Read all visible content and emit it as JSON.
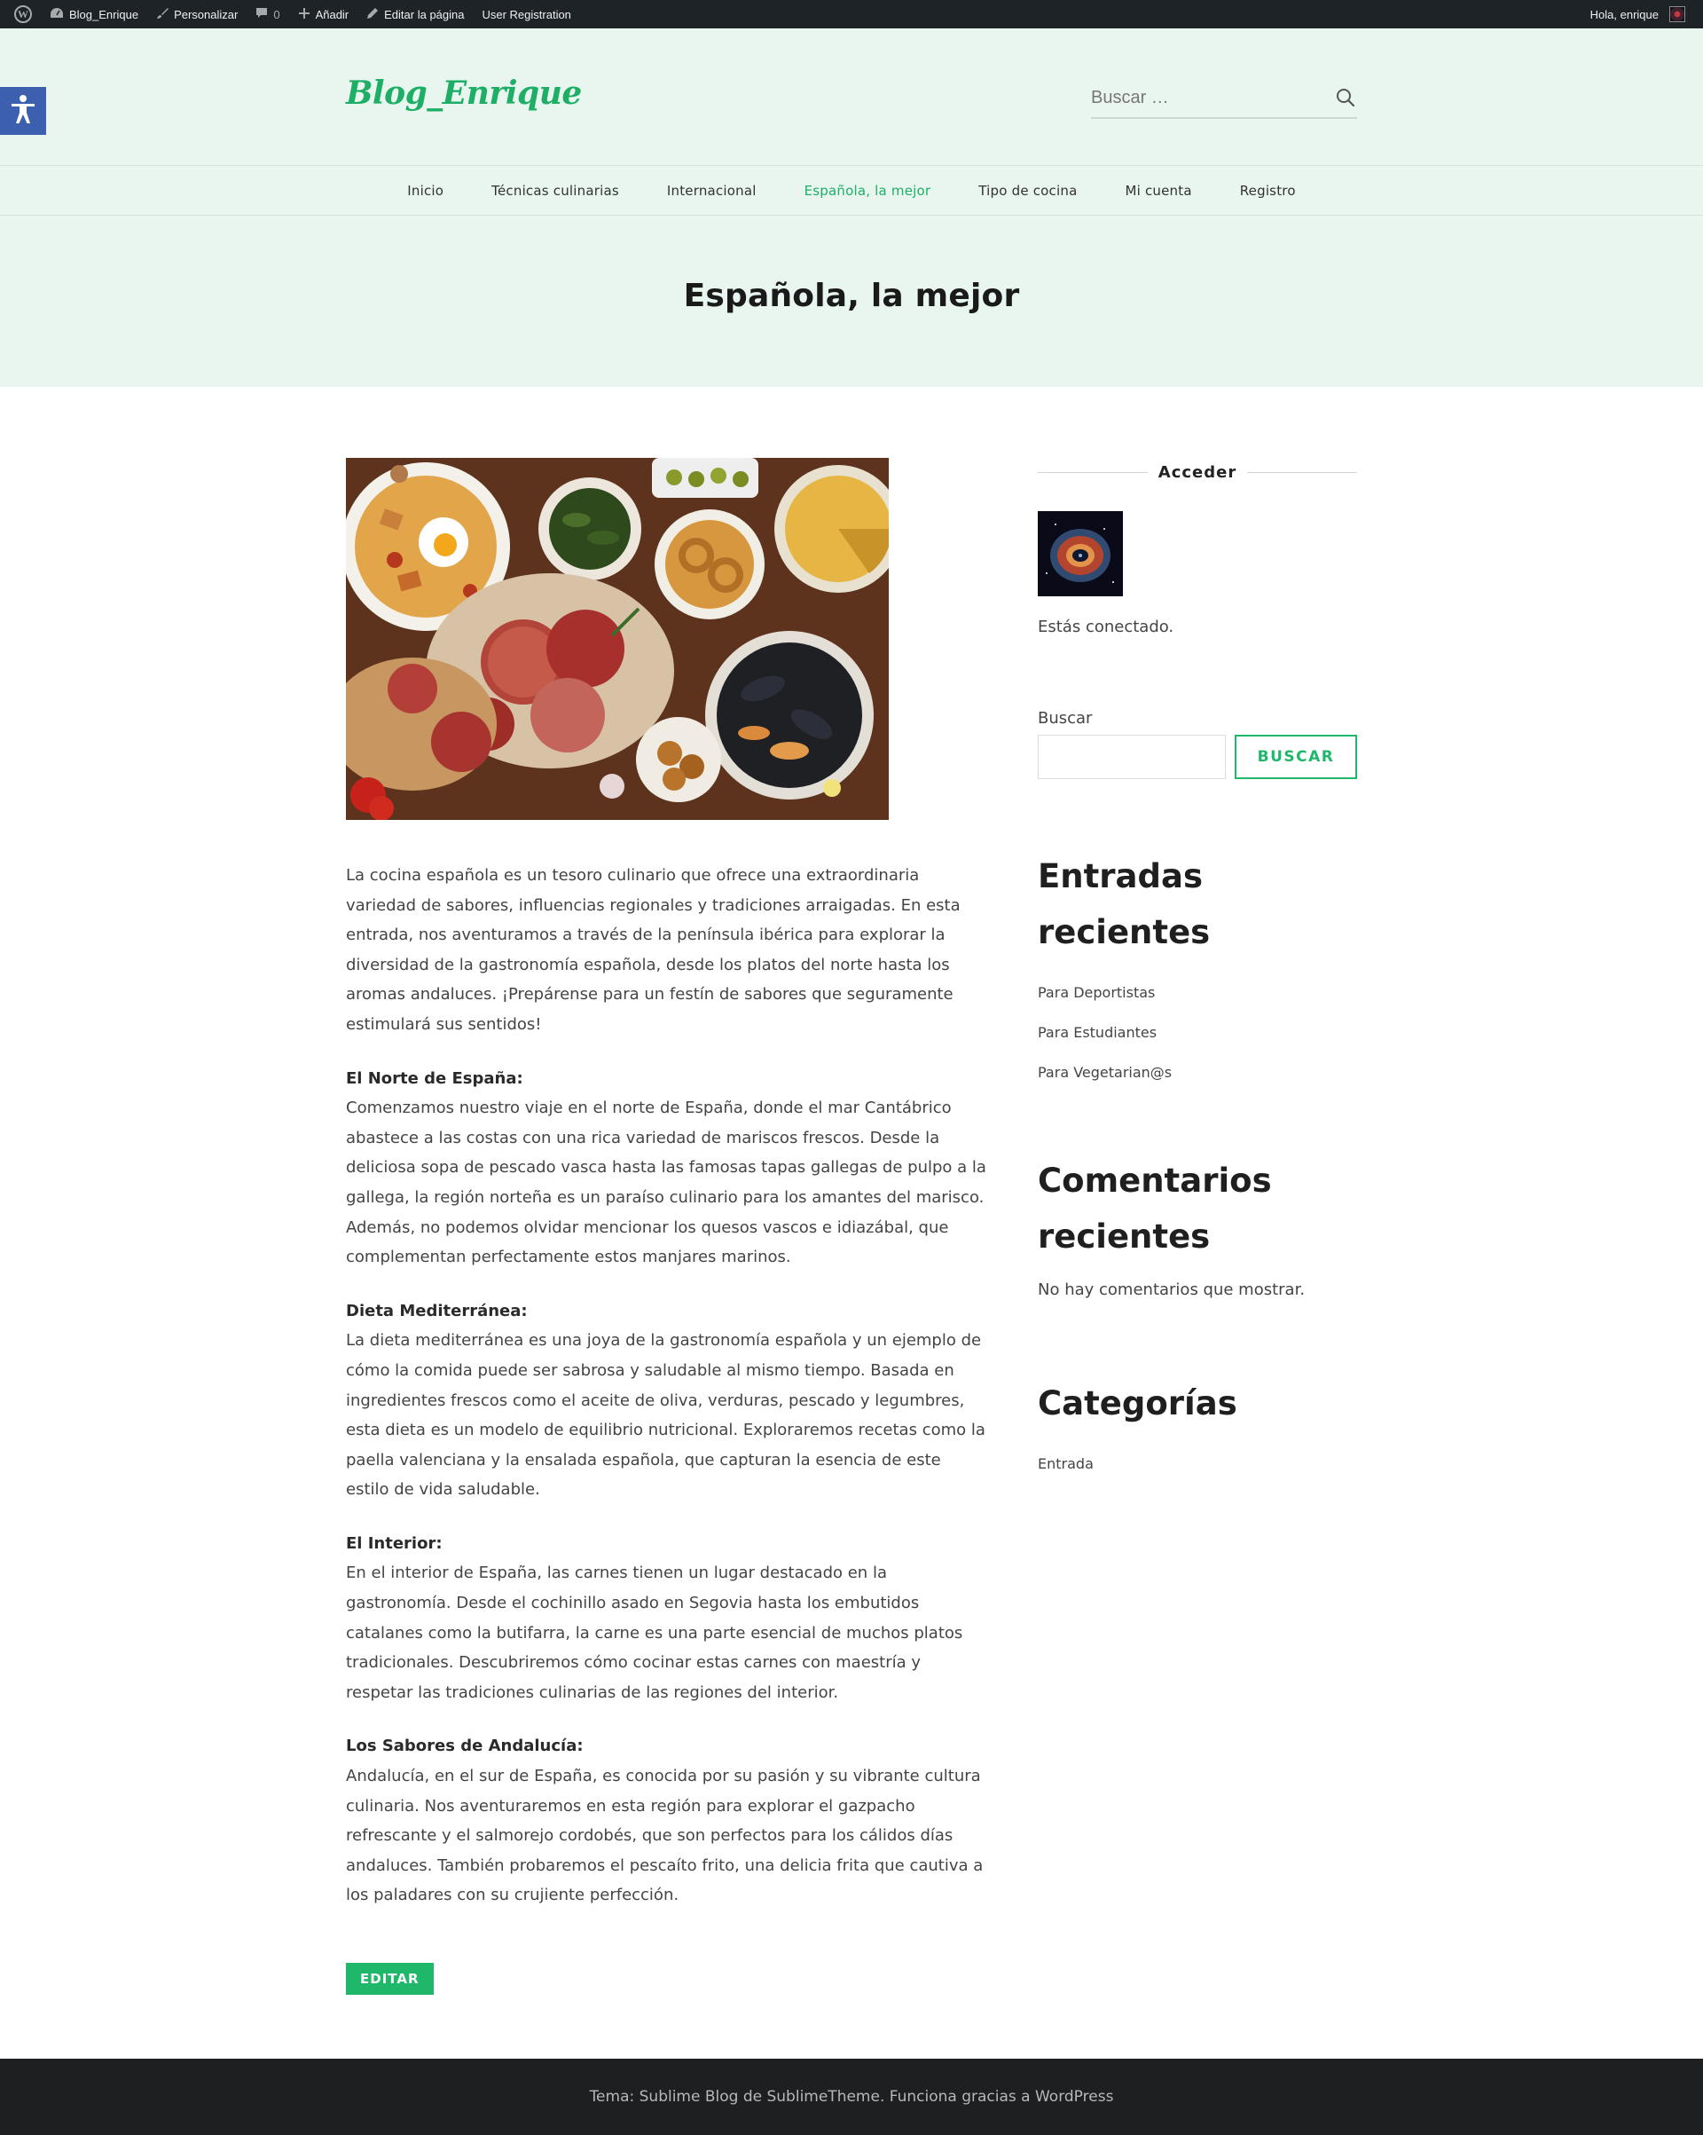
{
  "admin_bar": {
    "site_name": "Blog_Enrique",
    "customize": "Personalizar",
    "comments_count": "0",
    "add_new": "Añadir",
    "edit_page": "Editar la página",
    "user_registration": "User Registration",
    "greeting": "Hola, enrique"
  },
  "header": {
    "logo": "Blog_Enrique",
    "search_placeholder": "Buscar …"
  },
  "nav": {
    "items": [
      {
        "label": "Inicio",
        "active": false
      },
      {
        "label": "Técnicas culinarias",
        "active": false
      },
      {
        "label": "Internacional",
        "active": false
      },
      {
        "label": "Española, la mejor",
        "active": true
      },
      {
        "label": "Tipo de cocina",
        "active": false
      },
      {
        "label": "Mi cuenta",
        "active": false
      },
      {
        "label": "Registro",
        "active": false
      }
    ]
  },
  "page": {
    "title": "Española, la mejor",
    "intro": "La cocina española es un tesoro culinario que ofrece una extraordinaria variedad de sabores, influencias regionales y tradiciones arraigadas. En esta entrada, nos aventuramos a través de la península ibérica para explorar la diversidad de la gastronomía española, desde los platos del norte hasta los aromas andaluces. ¡Prepárense para un festín de sabores que seguramente estimulará sus sentidos!",
    "sections": [
      {
        "heading": "El Norte de España:",
        "body": "Comenzamos nuestro viaje en el norte de España, donde el mar Cantábrico abastece a las costas con una rica variedad de mariscos frescos. Desde la deliciosa sopa de pescado vasca hasta las famosas tapas gallegas de pulpo a la gallega, la región norteña es un paraíso culinario para los amantes del marisco. Además, no podemos olvidar mencionar los quesos vascos e idiazábal, que complementan perfectamente estos manjares marinos."
      },
      {
        "heading": "Dieta Mediterránea:",
        "body": "La dieta mediterránea es una joya de la gastronomía española y un ejemplo de cómo la comida puede ser sabrosa y saludable al mismo tiempo. Basada en ingredientes frescos como el aceite de oliva, verduras, pescado y legumbres, esta dieta es un modelo de equilibrio nutricional. Exploraremos recetas como la paella valenciana y la ensalada española, que capturan la esencia de este estilo de vida saludable."
      },
      {
        "heading": "El Interior:",
        "body": "En el interior de España, las carnes tienen un lugar destacado en la gastronomía. Desde el cochinillo asado en Segovia hasta los embutidos catalanes como la butifarra, la carne es una parte esencial de muchos platos tradicionales. Descubriremos cómo cocinar estas carnes con maestría y respetar las tradiciones culinarias de las regiones del interior."
      },
      {
        "heading": "Los Sabores de Andalucía:",
        "body": "Andalucía, en el sur de España, es conocida por su pasión y su vibrante cultura culinaria. Nos aventuraremos en esta región para explorar el gazpacho refrescante y el salmorejo cordobés, que son perfectos para los cálidos días andaluces. También probaremos el pescaíto frito, una delicia frita que cautiva a los paladares con su crujiente perfección."
      }
    ],
    "edit_label": "EDITAR"
  },
  "sidebar": {
    "login_title": "Acceder",
    "connected_text": "Estás conectado.",
    "search_label": "Buscar",
    "search_button": "BUSCAR",
    "recent_posts_title": "Entradas recientes",
    "recent_posts": [
      "Para Deportistas",
      "Para Estudiantes",
      "Para Vegetarian@s"
    ],
    "recent_comments_title": "Comentarios recientes",
    "no_comments": "No hay comentarios que mostrar.",
    "categories_title": "Categorías",
    "categories": [
      "Entrada"
    ]
  },
  "footer": {
    "text": "Tema: Sublime Blog de SublimeTheme. Funciona gracias a WordPress"
  },
  "colors": {
    "accent": "#1fae66",
    "header_bg": "#e8f6ef",
    "admin_bar_bg": "#1d2327",
    "footer_bg": "#1d1f20",
    "a11y_button": "#3d5fb0"
  }
}
